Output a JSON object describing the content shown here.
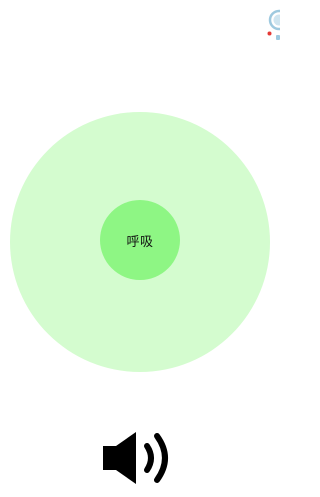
{
  "breath": {
    "label": "呼吸"
  },
  "colors": {
    "outer_circle": "#d4fccf",
    "inner_circle": "#8ef684",
    "speaker": "#000000",
    "corner_dot": "#e53935",
    "corner_arc": "#9ec9df"
  },
  "icons": {
    "sound": "speaker-volume-icon",
    "corner": "partial-avatar-icon"
  }
}
